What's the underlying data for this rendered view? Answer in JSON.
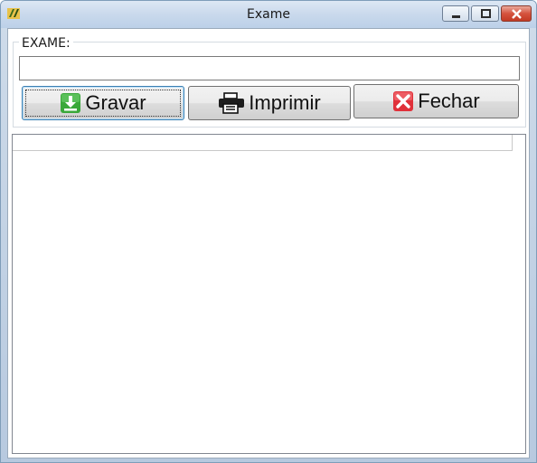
{
  "window": {
    "title": "Exame",
    "app_icon": "delphi-app-icon",
    "controls": [
      "minimize-icon",
      "maximize-icon",
      "close-icon"
    ]
  },
  "form": {
    "group_label": "EXAME:",
    "exame_value": "",
    "buttons": {
      "gravar": {
        "label": "Gravar",
        "icon": "download-save-icon"
      },
      "imprimir": {
        "label": "Imprimir",
        "icon": "printer-icon"
      },
      "fechar": {
        "label": "Fechar",
        "icon": "close-x-icon"
      }
    }
  },
  "colors": {
    "close_red": "#d5533e",
    "save_green": "#3aa83a",
    "fechar_red": "#e0313a",
    "focus_blue": "#3c7fb1"
  }
}
